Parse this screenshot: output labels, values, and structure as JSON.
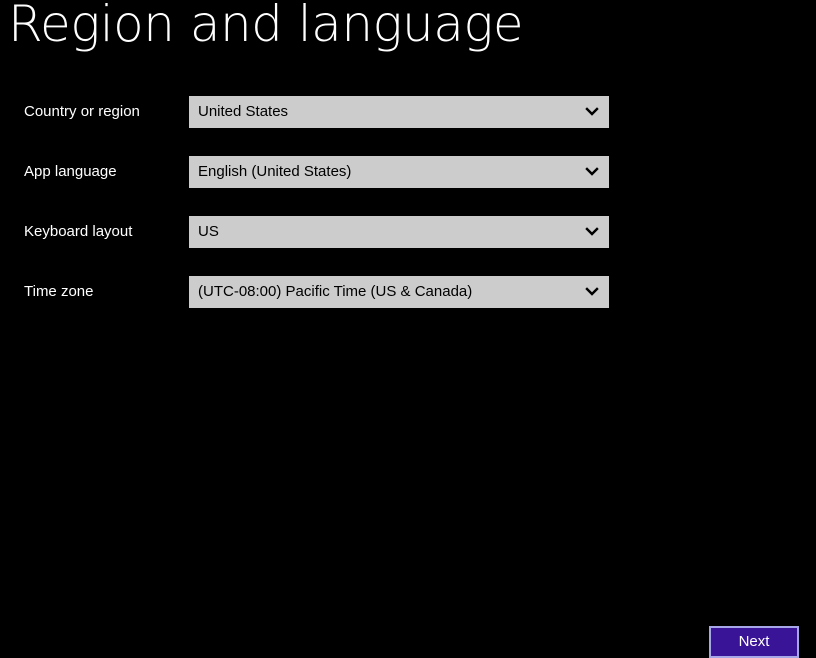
{
  "page": {
    "title": "Region and language"
  },
  "fields": [
    {
      "label": "Country or region",
      "value": "United States",
      "icon": "chevron-down-icon"
    },
    {
      "label": "App language",
      "value": "English (United States)",
      "icon": "chevron-down-icon"
    },
    {
      "label": "Keyboard layout",
      "value": "US",
      "icon": "chevron-down-icon"
    },
    {
      "label": "Time zone",
      "value": "(UTC-08:00) Pacific Time (US & Canada)",
      "icon": "chevron-down-icon"
    }
  ],
  "actions": {
    "next_label": "Next"
  },
  "colors": {
    "background": "#000000",
    "select_background": "#cccccc",
    "accent": "#3a1496",
    "accent_border": "#a6a6e8"
  }
}
